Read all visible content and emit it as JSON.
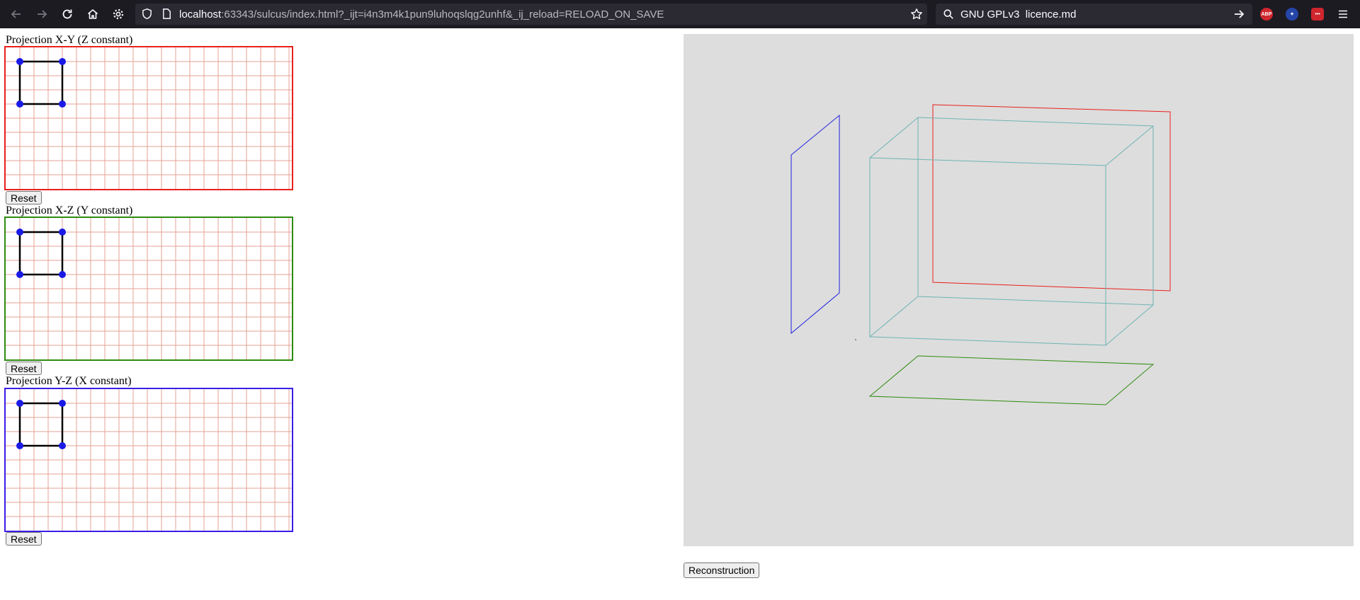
{
  "browser": {
    "url_host": "localhost",
    "url_rest": ":63343/sulcus/index.html?_ijt=i4n3m4k1pun9luhoqslqg2unhf&_ij_reload=RELOAD_ON_SAVE",
    "search_text": "GNU GPLv3  licence.md",
    "ext_abp": "ABP",
    "ext_red": "•••"
  },
  "projections": [
    {
      "title": "Projection X-Y (Z constant)",
      "reset_label": "Reset",
      "border_color": "#e8211d"
    },
    {
      "title": "Projection X-Z (Y constant)",
      "reset_label": "Reset",
      "border_color": "#2e8b0e"
    },
    {
      "title": "Projection Y-Z (X constant)",
      "reset_label": "Reset",
      "border_color": "#3a1ee6"
    }
  ],
  "viewer": {
    "background": "#dddddd",
    "reconstruction_label": "Reconstruction",
    "colors": {
      "cube": "#6fb3b3",
      "xy_plane": "#e8211d",
      "xz_plane": "#2e8b0e",
      "yz_plane": "#2020e0"
    }
  },
  "grid_colors": {
    "line": "#e6a294",
    "point": "#1a1ae6",
    "square": "#000000"
  }
}
